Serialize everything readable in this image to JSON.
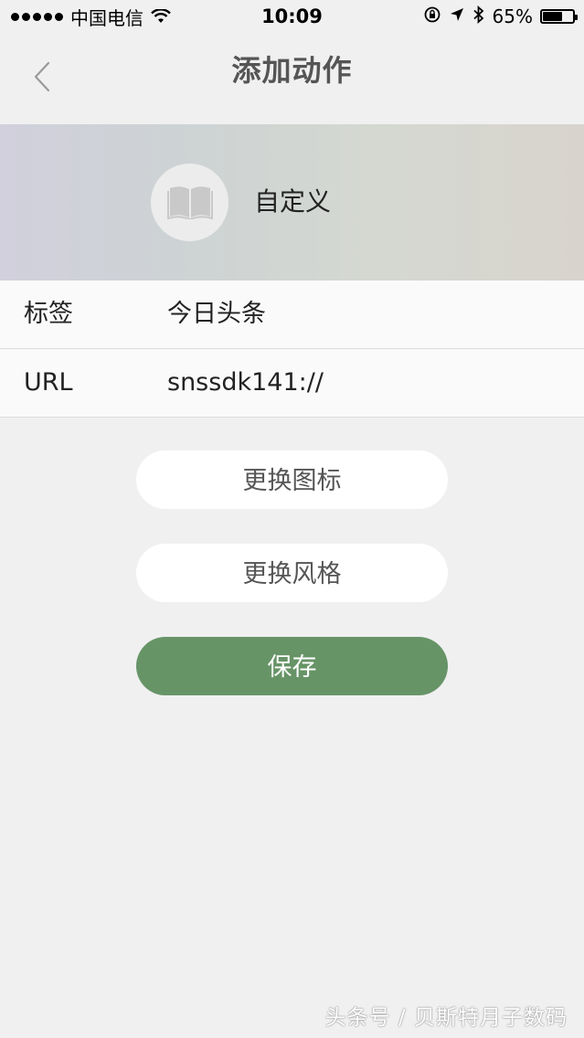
{
  "status_bar": {
    "carrier": "中国电信",
    "time": "10:09",
    "battery_percent": "65%",
    "battery_level": 0.65
  },
  "nav": {
    "title": "添加动作",
    "back_icon": "chevron-left-icon"
  },
  "banner": {
    "icon": "book-icon",
    "label": "自定义"
  },
  "form": {
    "rows": [
      {
        "label": "标签",
        "value": "今日头条"
      },
      {
        "label": "URL",
        "value": "snssdk141://"
      }
    ]
  },
  "buttons": {
    "change_icon": "更换图标",
    "change_style": "更换风格",
    "save": "保存",
    "save_color": "#679467"
  },
  "watermark": "头条号 / 贝斯特月子数码"
}
